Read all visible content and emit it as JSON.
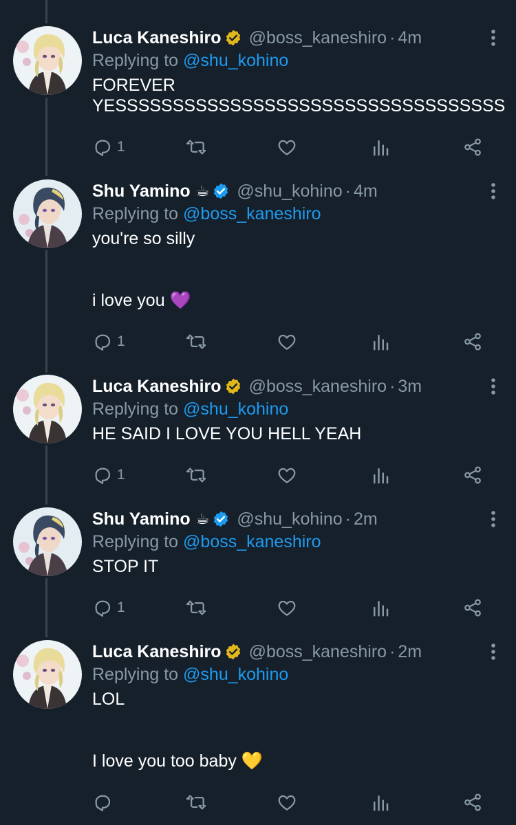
{
  "colors": {
    "background": "#15202b",
    "secondary_text": "#8899a6",
    "mention": "#1d9bf0",
    "verified_blue": "#1d9bf0",
    "verified_gold": "#e2b719"
  },
  "tweets": [
    {
      "name": "Luca Kaneshiro",
      "emoji": "",
      "badge": "gold-verified-badge-icon",
      "handle": "@boss_kaneshiro",
      "separator": "·",
      "time": "4m",
      "replying_prefix": "Replying to",
      "replying_to": "@shu_kohino",
      "text_lines": [
        "FOREVER",
        "YESSSSSSSSSSSSSSSSSSSSSSSSSSSSSSSSSS"
      ],
      "reply_count": "1",
      "avatar": "luca-avatar"
    },
    {
      "name": "Shu Yamino",
      "emoji": "☕",
      "badge": "blue-verified-badge-icon",
      "handle": "@shu_kohino",
      "separator": "·",
      "time": "4m",
      "replying_prefix": "Replying to",
      "replying_to": "@boss_kaneshiro",
      "text_lines": [
        "you're so silly",
        "i love you 💜"
      ],
      "reply_count": "1",
      "avatar": "shu-avatar"
    },
    {
      "name": "Luca Kaneshiro",
      "emoji": "",
      "badge": "gold-verified-badge-icon",
      "handle": "@boss_kaneshiro",
      "separator": "·",
      "time": "3m",
      "replying_prefix": "Replying to",
      "replying_to": "@shu_kohino",
      "text_lines": [
        "HE SAID I LOVE YOU HELL YEAH"
      ],
      "reply_count": "1",
      "avatar": "luca-avatar"
    },
    {
      "name": "Shu Yamino",
      "emoji": "☕",
      "badge": "blue-verified-badge-icon",
      "handle": "@shu_kohino",
      "separator": "·",
      "time": "2m",
      "replying_prefix": "Replying to",
      "replying_to": "@boss_kaneshiro",
      "text_lines": [
        "STOP IT"
      ],
      "reply_count": "1",
      "avatar": "shu-avatar"
    },
    {
      "name": "Luca Kaneshiro",
      "emoji": "",
      "badge": "gold-verified-badge-icon",
      "handle": "@boss_kaneshiro",
      "separator": "·",
      "time": "2m",
      "replying_prefix": "Replying to",
      "replying_to": "@shu_kohino",
      "text_lines": [
        "LOL",
        "I love you too baby 💛"
      ],
      "reply_count": "",
      "avatar": "luca-avatar"
    }
  ]
}
